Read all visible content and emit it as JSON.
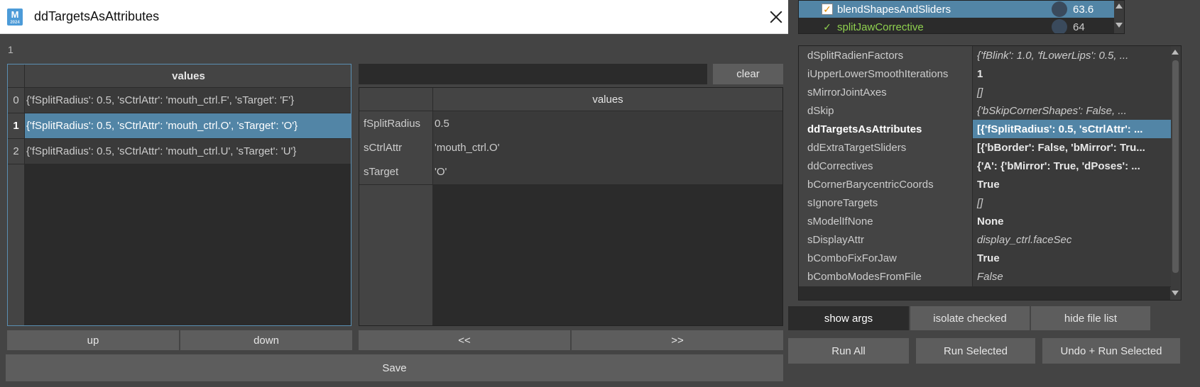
{
  "bg_panel": {
    "top_list": [
      {
        "label": "blendShapesAndSliders",
        "value": "63.6",
        "selected": true,
        "check": "box"
      },
      {
        "label": "splitJawCorrective",
        "value": "64",
        "selected": false,
        "check": "plain"
      }
    ],
    "args": [
      {
        "key": "dSplitRadienFactors",
        "value": "{'fBlink': 1.0, 'fLowerLips': 0.5, ...",
        "style": "i"
      },
      {
        "key": "iUpperLowerSmoothIterations",
        "value": "1",
        "style": "b"
      },
      {
        "key": "sMirrorJointAxes",
        "value": "[]",
        "style": "i"
      },
      {
        "key": "dSkip",
        "value": "{'bSkipCornerShapes': False, ...",
        "style": "i"
      },
      {
        "key": "ddTargetsAsAttributes",
        "value": "[{'fSplitRadius': 0.5, 'sCtrlAttr': ...",
        "style": "b",
        "selected": true
      },
      {
        "key": "ddExtraTargetSliders",
        "value": "[{'bBorder': False, 'bMirror': Tru...",
        "style": "b"
      },
      {
        "key": "ddCorrectives",
        "value": "{'A': {'bMirror': True, 'dPoses': ...",
        "style": "b"
      },
      {
        "key": "bCornerBarycentricCoords",
        "value": "True",
        "style": "b"
      },
      {
        "key": "sIgnoreTargets",
        "value": "[]",
        "style": "i"
      },
      {
        "key": "sModelIfNone",
        "value": "None",
        "style": "b"
      },
      {
        "key": "sDisplayAttr",
        "value": "display_ctrl.faceSec",
        "style": "i"
      },
      {
        "key": "bComboFixForJaw",
        "value": "True",
        "style": "b"
      },
      {
        "key": "bComboModesFromFile",
        "value": "False",
        "style": "i"
      }
    ],
    "show_args_label": "show args",
    "isolate_checked_label": "isolate checked",
    "hide_file_list_label": "hide file list",
    "run_all_label": "Run All",
    "run_selected_label": "Run Selected",
    "undo_run_selected_label": "Undo + Run Selected"
  },
  "dialog": {
    "app_icon_letter": "M",
    "app_icon_sub": "2024",
    "title": "ddTargetsAsAttributes",
    "index_label": "1",
    "list_header": "values",
    "list_rows": [
      {
        "index": "0",
        "text": "{'fSplitRadius': 0.5, 'sCtrlAttr': 'mouth_ctrl.F', 'sTarget': 'F'}"
      },
      {
        "index": "1",
        "text": "{'fSplitRadius': 0.5, 'sCtrlAttr': 'mouth_ctrl.O', 'sTarget': 'O'}"
      },
      {
        "index": "2",
        "text": "{'fSplitRadius': 0.5, 'sCtrlAttr': 'mouth_ctrl.U', 'sTarget': 'U'}"
      }
    ],
    "selected_row": 1,
    "up_label": "up",
    "down_label": "down",
    "filter_value": "",
    "clear_label": "clear",
    "dict_header": "values",
    "dict_rows": [
      {
        "key": "fSplitRadius",
        "value": "0.5"
      },
      {
        "key": "sCtrlAttr",
        "value": "'mouth_ctrl.O'"
      },
      {
        "key": "sTarget",
        "value": "'O'"
      }
    ],
    "prev_label": "<<",
    "next_label": ">>",
    "save_label": "Save"
  },
  "colors": {
    "selection": "#5285a6",
    "panel": "#444444",
    "field": "#2b2b2b",
    "check_green": "#8fd14f",
    "check_orange": "#e08a00"
  }
}
